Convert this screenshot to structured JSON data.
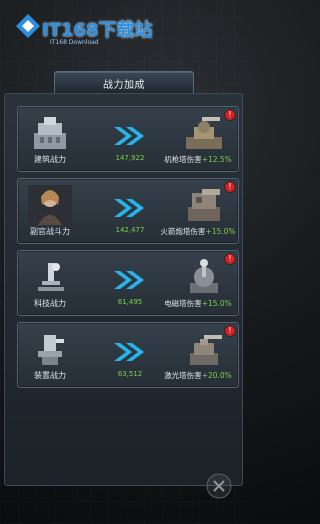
{
  "watermark": {
    "brand": "IT168下载站",
    "sub": "IT168 Download"
  },
  "panel": {
    "title": "战力加成"
  },
  "rows": [
    {
      "name": "建筑战力",
      "value": "147,922",
      "effect": "机枪塔伤害",
      "bonus": "+12.5%"
    },
    {
      "name": "副官战斗力",
      "value": "142,477",
      "effect": "火箭炮塔伤害",
      "bonus": "+15.0%"
    },
    {
      "name": "科技战力",
      "value": "61,495",
      "effect": "电磁塔伤害",
      "bonus": "+15.0%"
    },
    {
      "name": "装置战力",
      "value": "63,512",
      "effect": "激光塔伤害",
      "bonus": "+20.0%"
    }
  ],
  "alert_mark": "!",
  "colors": {
    "accent_green": "#7ed047",
    "arrow_cyan": "#27b4ea",
    "alert_red": "#d81f1f"
  },
  "icons": [
    "building-icon",
    "officer-portrait",
    "microscope-icon",
    "device-icon",
    "tower-icon",
    "double-chevron-icon",
    "alert-icon"
  ]
}
